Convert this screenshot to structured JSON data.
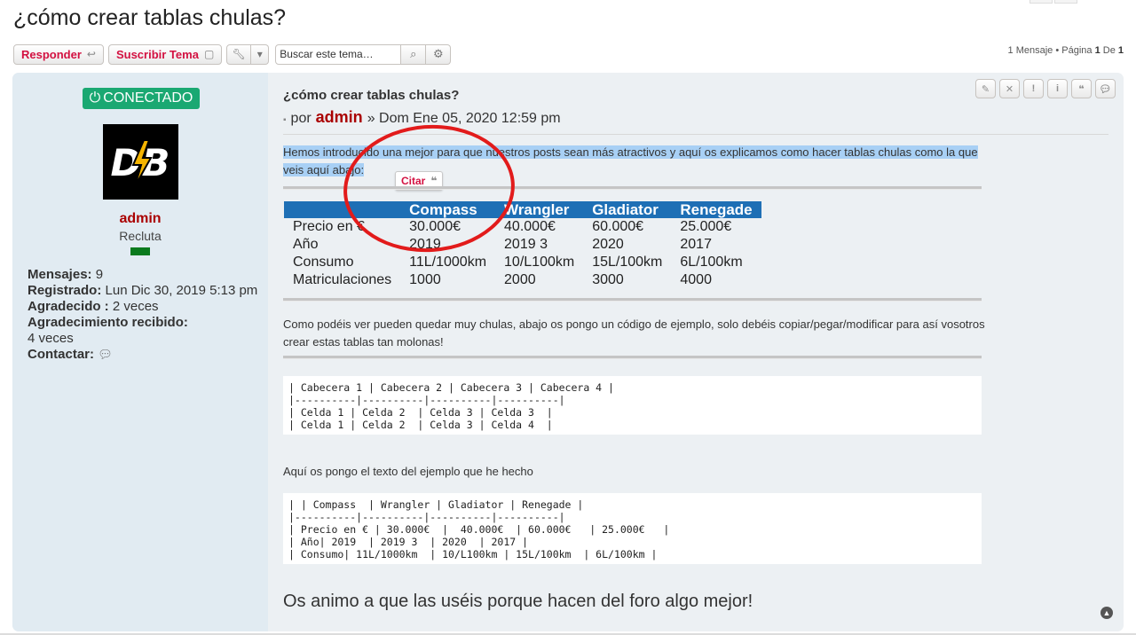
{
  "page": {
    "title": "¿cómo crear tablas chulas?"
  },
  "toolbar": {
    "reply_label": "Responder",
    "subscribe_label": "Suscribir Tema",
    "search_placeholder": "Buscar este tema…"
  },
  "pagination": {
    "prefix": "1 Mensaje • Página",
    "current": "1",
    "of": "De",
    "total": "1"
  },
  "profile": {
    "online_label": "CONECTADO",
    "avatar_text": "DB",
    "username": "admin",
    "rank": "Recluta",
    "posts_label": "Mensajes:",
    "posts_value": "9",
    "registered_label": "Registrado:",
    "registered_value": "Lun Dic 30, 2019 5:13 pm",
    "thanked_label": "Agradecido :",
    "thanked_value": "2 veces",
    "thanks_received_label": "Agradecimiento recibido:",
    "thanks_received_value": "4 veces",
    "contact_label": "Contactar:"
  },
  "post": {
    "subject": "¿cómo crear tablas chulas?",
    "by_label": "por",
    "author": "admin",
    "date": "» Dom Ene 05, 2020 12:59 pm",
    "intro": "Hemos introducido una mejor para que nuestros posts sean más atractivos y aquí os explicamos como hacer tablas chulas como la que veis aquí abajo:",
    "quote_popup_label": "Citar",
    "table": {
      "headers": [
        "",
        "Compass",
        "Wrangler",
        "Gladiator",
        "Renegade"
      ],
      "rows": [
        [
          "Precio en €",
          "30.000€",
          "40.000€",
          "60.000€",
          "25.000€"
        ],
        [
          "Año",
          "2019",
          "2019 3",
          "2020",
          "2017"
        ],
        [
          "Consumo",
          "11L/1000km",
          "10/L100km",
          "15L/100km",
          "6L/100km"
        ],
        [
          "Matriculaciones",
          "1000",
          "2000",
          "3000",
          "4000"
        ]
      ]
    },
    "para2": "Como podéis ver pueden quedar muy chulas, abajo os pongo un código de ejemplo, solo debéis copiar/pegar/modificar para así vosotros crear estas tablas tan molonas!",
    "code1": "| Cabecera 1 | Cabecera 2 | Cabecera 3 | Cabecera 4 |\n|----------|----------|----------|----------|\n| Celda 1 | Celda 2  | Celda 3 | Celda 3  |\n| Celda 1 | Celda 2  | Celda 3 | Celda 4  |",
    "para3": "Aquí os pongo el texto del ejemplo que he hecho",
    "code2": "| | Compass  | Wrangler | Gladiator | Renegade |\n|----------|----------|----------|----------|\n| Precio en € | 30.000€  |  40.000€  | 60.000€   | 25.000€   |\n| Año| 2019  | 2019 3  | 2020  | 2017 |\n| Consumo| 11L/1000km  | 10/L100km | 15L/100km  | 6L/100km |",
    "closing": "Os animo a que las uséis porque hacen del foro algo mejor!"
  },
  "colors": {
    "accent_red": "#d31141",
    "online_green": "#1aa872",
    "table_header_blue": "#1e6fb5",
    "annotation_circle": "#e21b1b"
  }
}
